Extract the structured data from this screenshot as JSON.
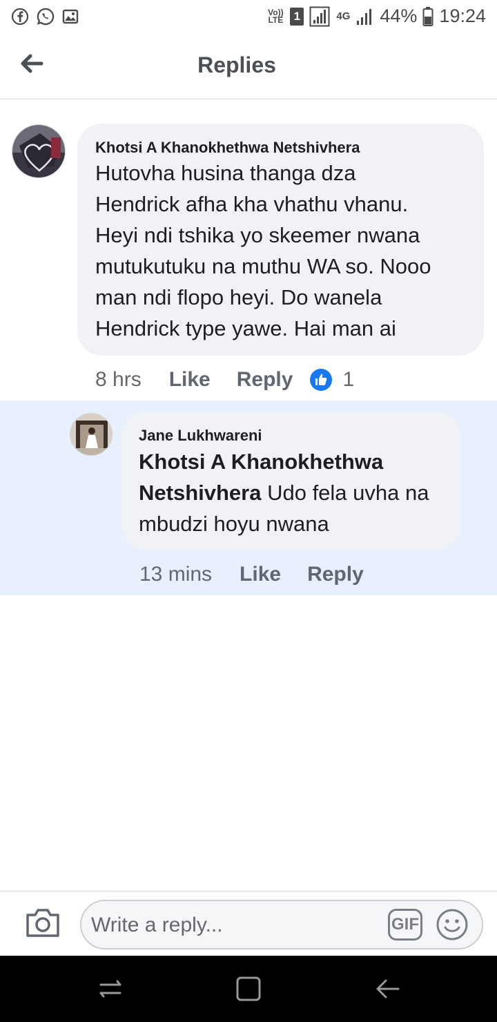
{
  "status_bar": {
    "volte": "Vo)) LTE",
    "sim": "1",
    "network": "4G",
    "battery": "44%",
    "time": "19:24"
  },
  "header": {
    "title": "Replies"
  },
  "comment": {
    "author": "Khotsi A Khanokhethwa Netshivhera",
    "lines": [
      "Hutovha husina thanga dza",
      "Hendrick afha kha vhathu vhanu.",
      "Heyi ndi tshika yo skeemer nwana",
      "mutukutuku na muthu WA so. Nooo",
      "man ndi flopo heyi. Do wanela",
      "Hendrick type yawe. Hai man ai"
    ],
    "time": "8 hrs",
    "like_label": "Like",
    "reply_label": "Reply",
    "reaction_count": "1"
  },
  "reply": {
    "author": "Jane Lukhwareni",
    "mention_line1": "Khotsi A Khanokhethwa",
    "mention_line2": "Netshivhera",
    "line2_rest": " Udo fela uvha na",
    "line3": "mbudzi hoyu nwana",
    "time": "13 mins",
    "like_label": "Like",
    "reply_label": "Reply"
  },
  "composer": {
    "placeholder": "Write a reply...",
    "gif_label": "GIF"
  },
  "colors": {
    "bubble": "#f0f2f5",
    "highlight": "#e7f0fc",
    "like_blue": "#1877f2"
  }
}
